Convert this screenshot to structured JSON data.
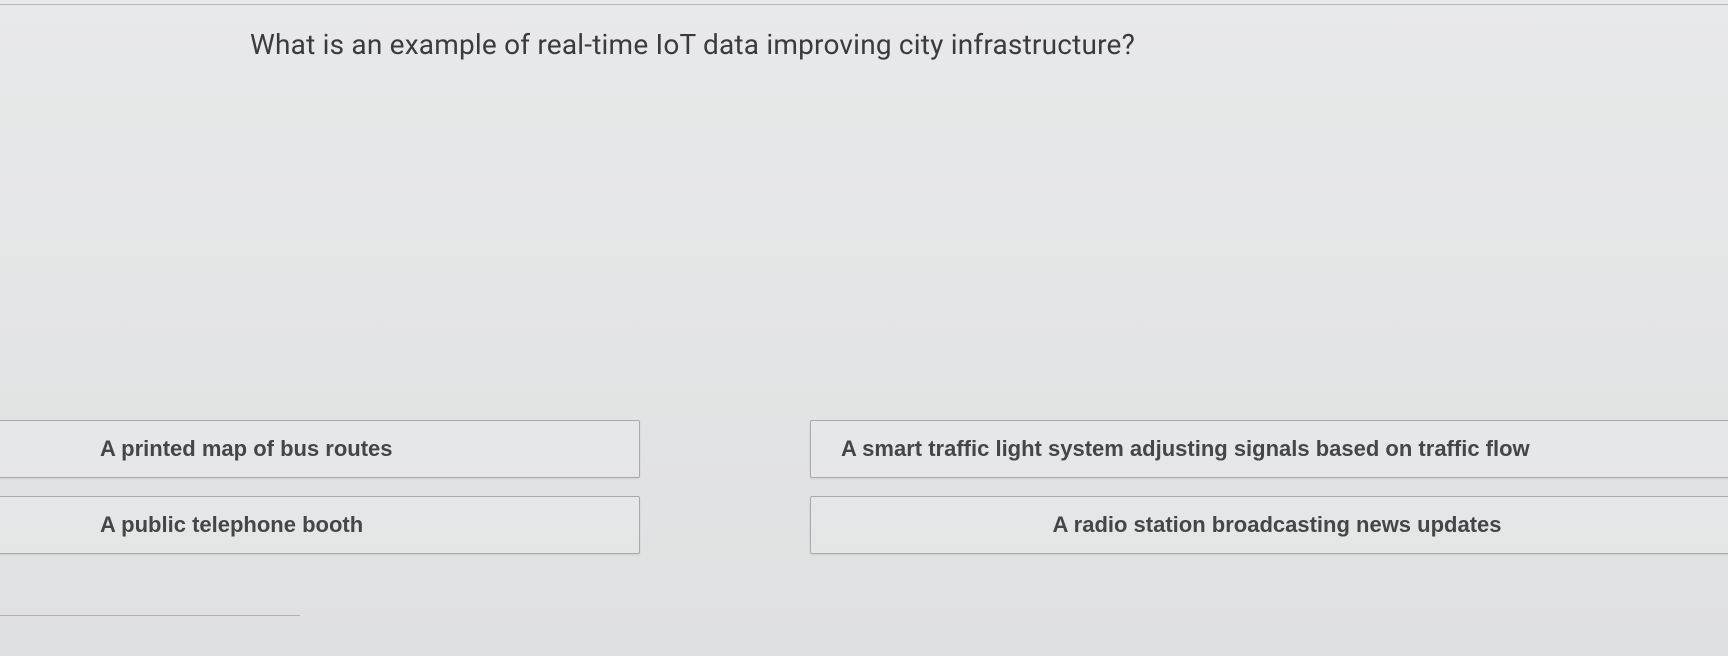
{
  "question": "What is an example of real-time IoT data improving city infrastructure?",
  "options": {
    "left": [
      "A printed map of bus routes",
      "A public telephone booth"
    ],
    "right": [
      "A smart traffic light system adjusting signals based on traffic flow",
      "A radio station broadcasting news updates"
    ]
  }
}
